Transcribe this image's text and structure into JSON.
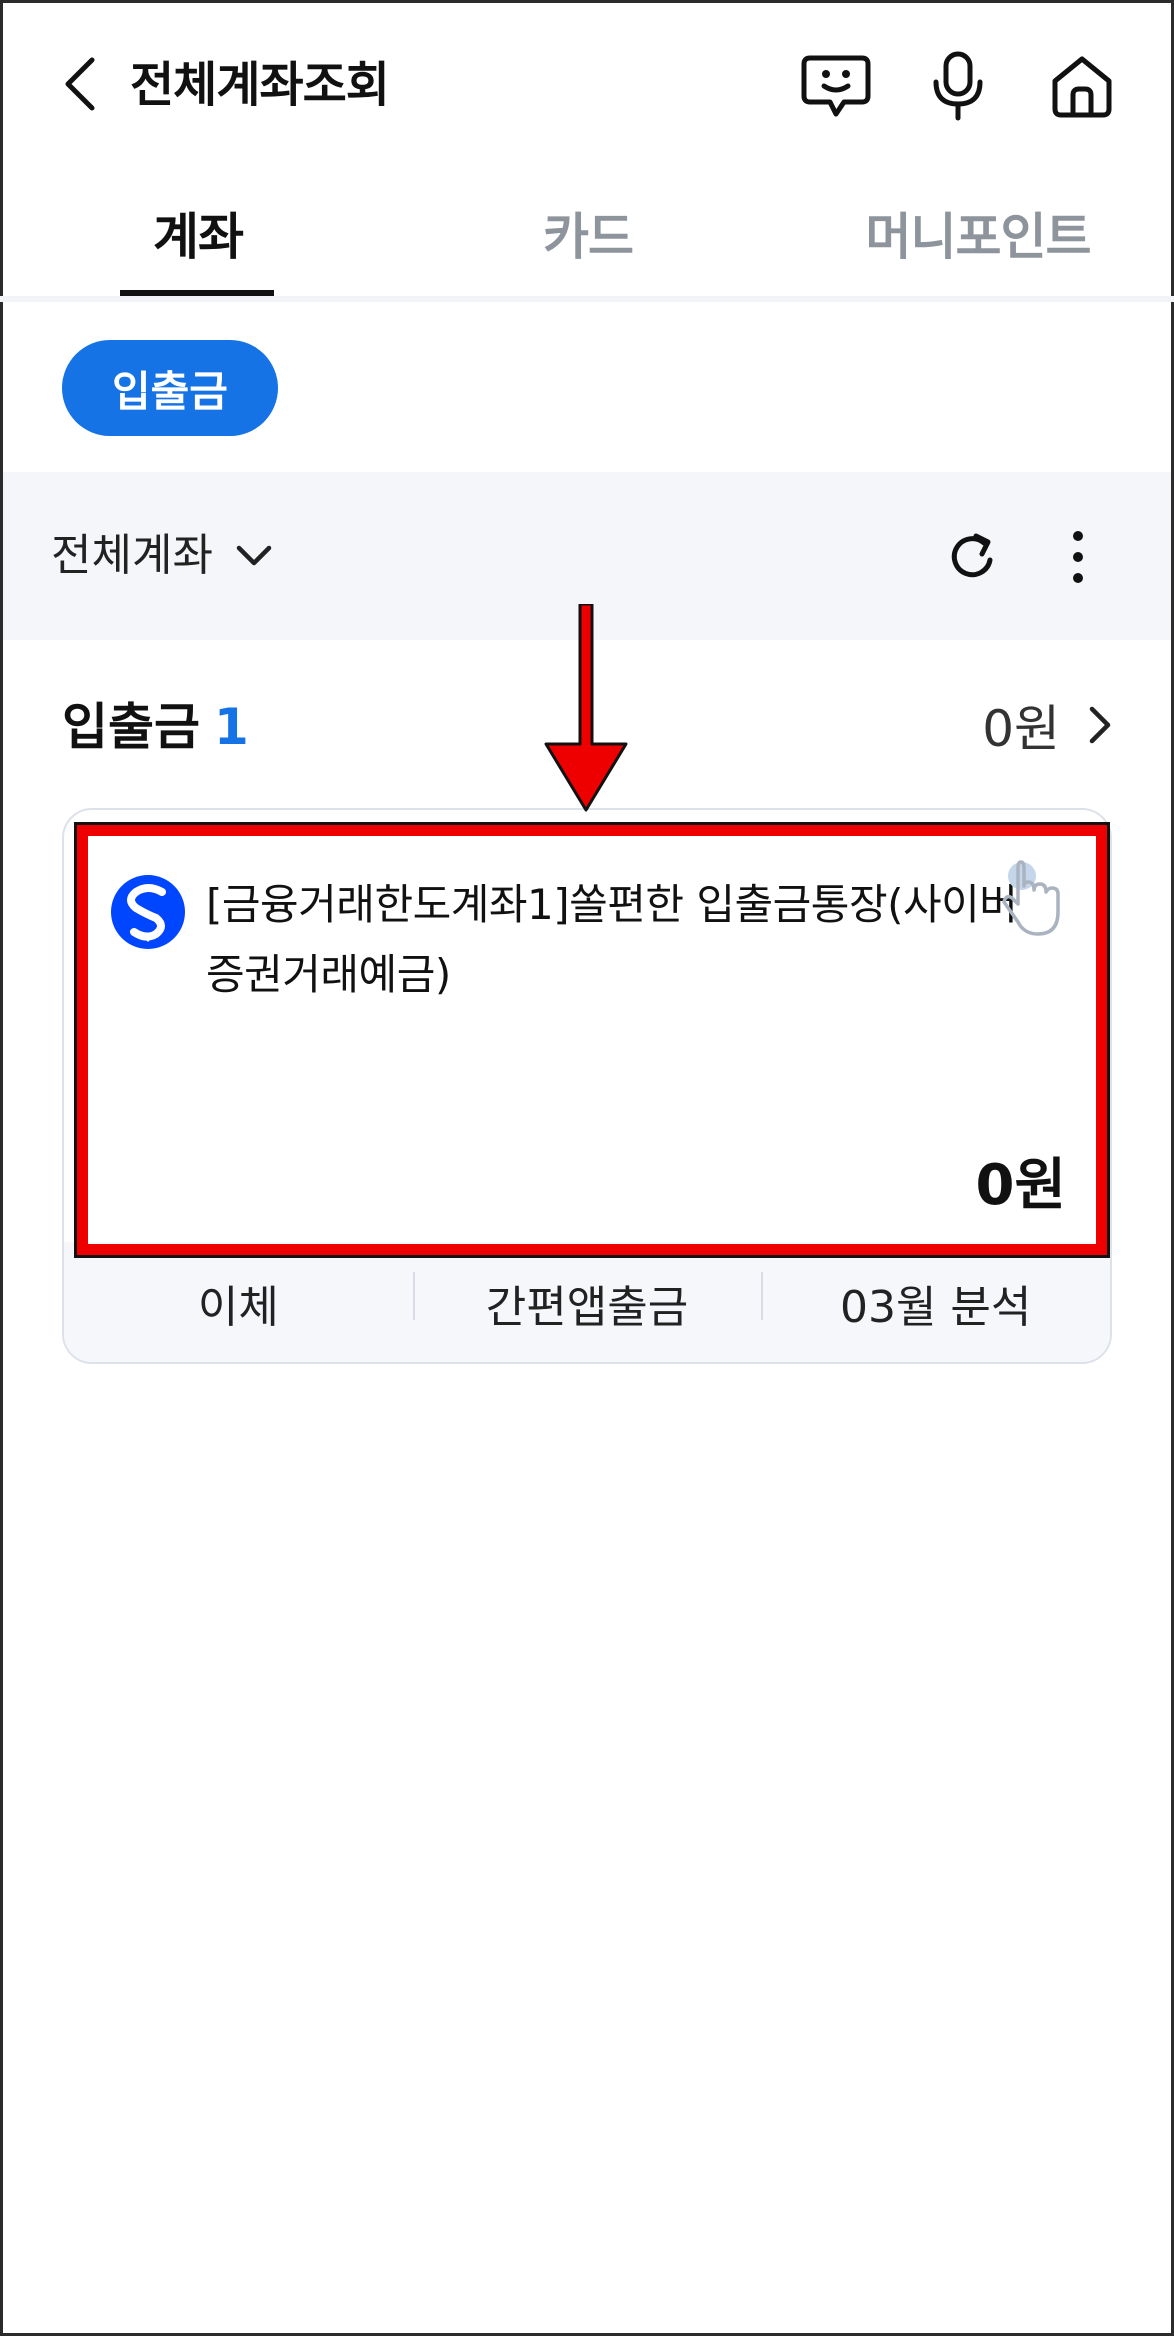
{
  "header": {
    "title": "전체계좌조회",
    "back_icon": "back-arrow-icon",
    "icons": [
      "chatbot-icon",
      "microphone-icon",
      "home-icon"
    ]
  },
  "tabs": [
    {
      "label": "계좌",
      "active": true
    },
    {
      "label": "카드",
      "active": false
    },
    {
      "label": "머니포인트",
      "active": false
    }
  ],
  "filter_chip": {
    "label": "입출금"
  },
  "filter_bar": {
    "label": "전체계좌",
    "icons": [
      "chevron-down-icon",
      "refresh-icon",
      "more-vertical-icon"
    ]
  },
  "section": {
    "title": "입출금",
    "count": "1",
    "total": "0원"
  },
  "account": {
    "name": "[금융거래한도계좌1]쏠편한 입출금통장(사이버증권거래예금)",
    "balance": "0원",
    "bank_icon": "shinhan-bank-logo-icon",
    "actions": [
      "이체",
      "간편앱출금",
      "03월 분석"
    ]
  },
  "colors": {
    "accent": "#1673e6",
    "highlight": "#ee0000",
    "filter_bg": "#f4f6fa"
  }
}
